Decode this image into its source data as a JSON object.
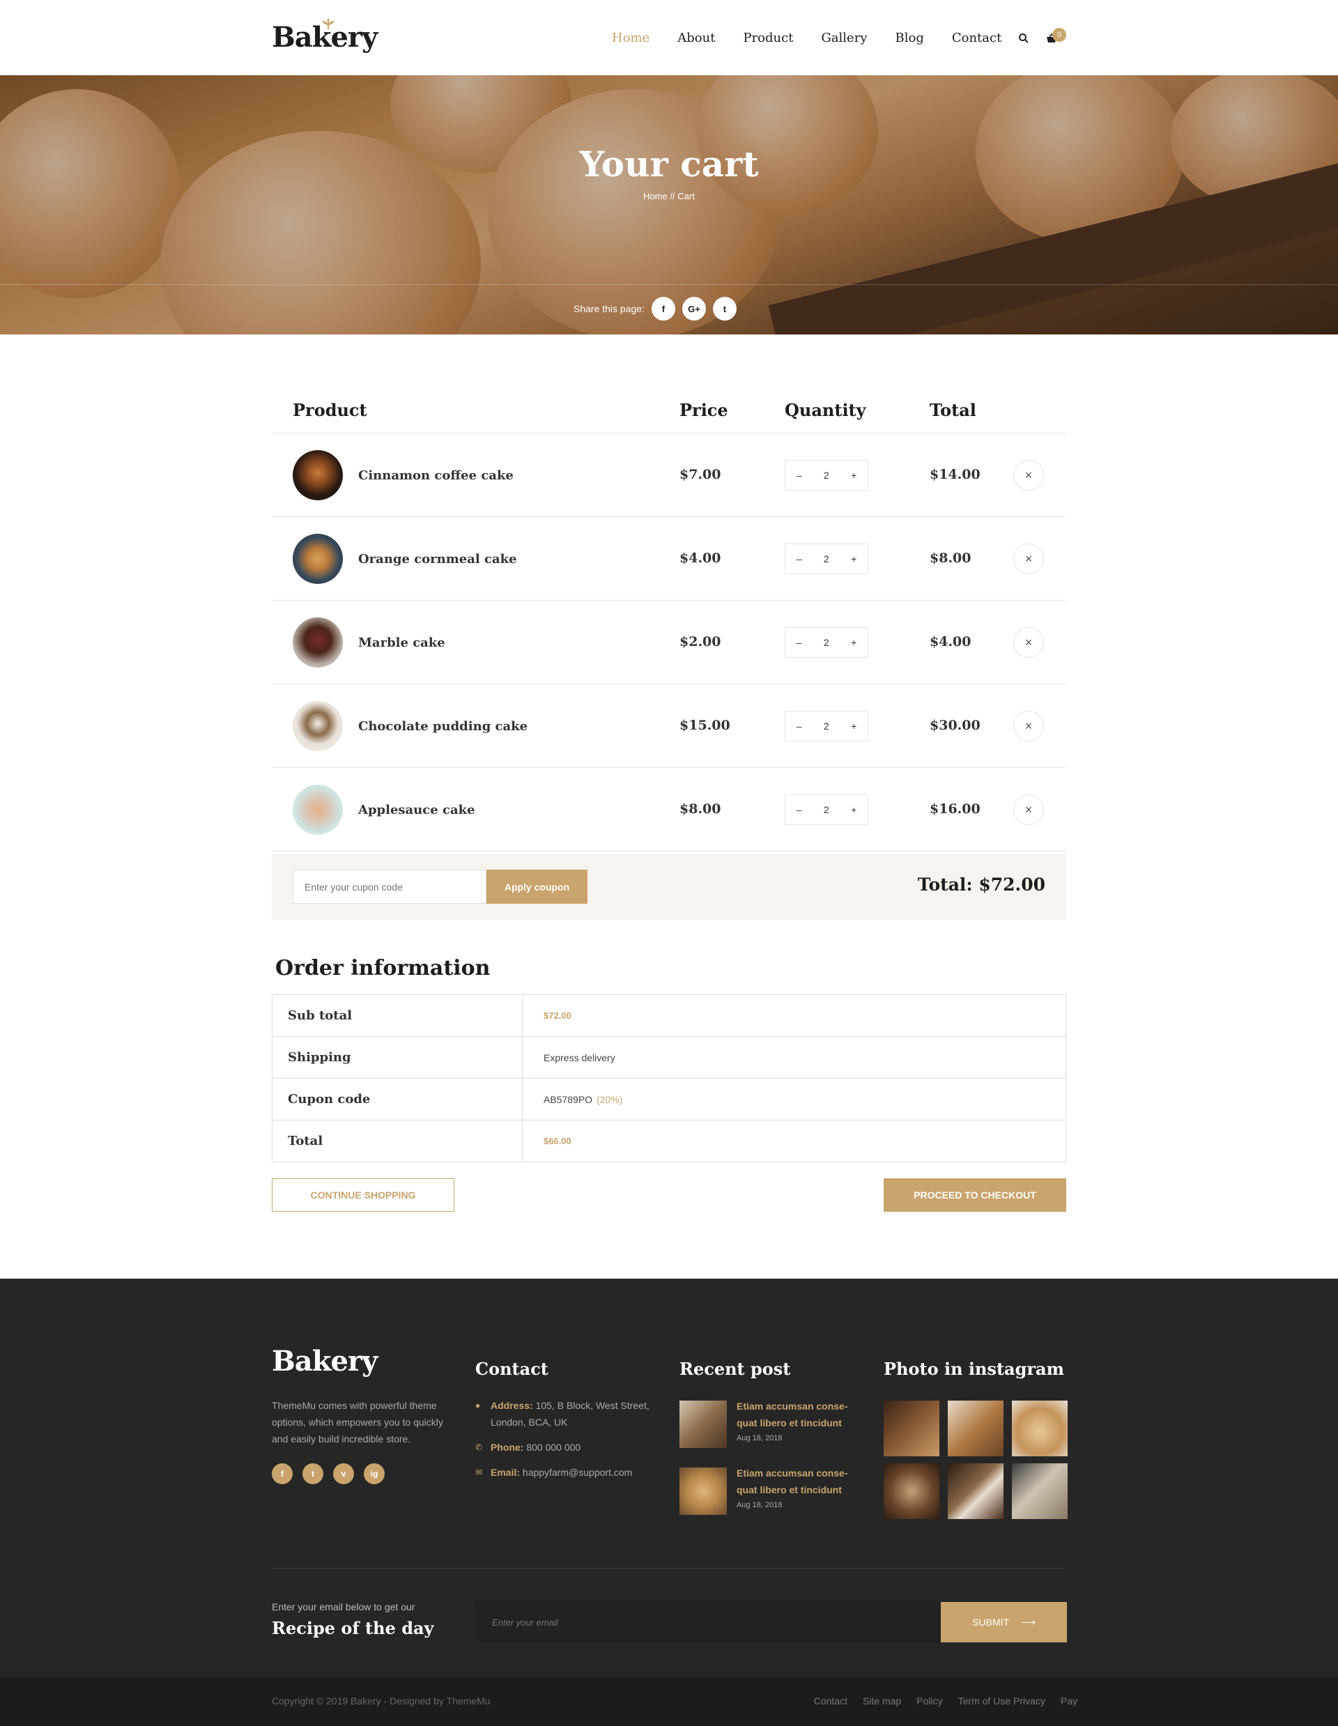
{
  "brand": {
    "logo": "Bakery",
    "accent": "#c9a46c",
    "dark": "#262626"
  },
  "nav": {
    "items": [
      "Home",
      "About",
      "Product",
      "Gallery",
      "Blog",
      "Contact"
    ],
    "active": "Home",
    "cart_count": "0"
  },
  "hero": {
    "title": "Your cart",
    "breadcrumb": "Home  //  Cart",
    "share_label": "Share this page:",
    "share_icons": [
      "f",
      "G+",
      "t"
    ]
  },
  "cart": {
    "headers": {
      "product": "Product",
      "price": "Price",
      "quantity": "Quantity",
      "total": "Total"
    },
    "items": [
      {
        "name": "Cinnamon coffee cake",
        "price": "$7.00",
        "qty": "2",
        "total": "$14.00"
      },
      {
        "name": "Orange cornmeal cake",
        "price": "$4.00",
        "qty": "2",
        "total": "$8.00"
      },
      {
        "name": "Marble cake",
        "price": "$2.00",
        "qty": "2",
        "total": "$4.00"
      },
      {
        "name": "Chocolate pudding cake",
        "price": "$15.00",
        "qty": "2",
        "total": "$30.00"
      },
      {
        "name": "Applesauce cake",
        "price": "$8.00",
        "qty": "2",
        "total": "$16.00"
      }
    ],
    "coupon_placeholder": "Enter your cupon code",
    "apply_label": "Apply coupon",
    "total_label": "Total: $72.00"
  },
  "order": {
    "title": "Order information",
    "rows": [
      {
        "label": "Sub total",
        "value": "$72.00"
      },
      {
        "label": "Shipping",
        "value": "Express delivery"
      },
      {
        "label": "Cupon code",
        "value": "AB5789PO",
        "extra": "(20%)"
      },
      {
        "label": "Total",
        "value": "$66.00"
      }
    ],
    "continue_label": "CONTINUE SHOPPING",
    "checkout_label": "PROCEED TO CHECKOUT"
  },
  "footer": {
    "logo": "Bakery",
    "about": "ThemeMu comes with powerful theme options, which empowers you to quickly and easily build incredible store.",
    "socials": [
      "f",
      "t",
      "v",
      "ig"
    ],
    "contact_title": "Contact",
    "address_label": "Address:",
    "address": "105, B Block, West Street, London, BCA, UK",
    "phone_label": "Phone:",
    "phone": "800 000 000",
    "email_label": "Email:",
    "email": "happyfarm@support.com",
    "recent_title": "Recent post",
    "posts": [
      {
        "title": "Etiam accumsan conse-quat libero et tincidunt",
        "date": "Aug 18, 2018"
      },
      {
        "title": "Etiam accumsan conse-quat libero et tincidunt",
        "date": "Aug 18, 2018"
      }
    ],
    "insta_title": "Photo in instagram",
    "newsletter_sub": "Enter your email below to get our",
    "newsletter_title": "Recipe of the day",
    "newsletter_placeholder": "Enter your email",
    "submit_label": "SUBMIT",
    "copyright": "Copyright © 2019 Bakery - Designed by ThemeMu",
    "links": [
      "Contact",
      "Site map",
      "Policy",
      "Term of Use Privacy",
      "Pay"
    ]
  }
}
